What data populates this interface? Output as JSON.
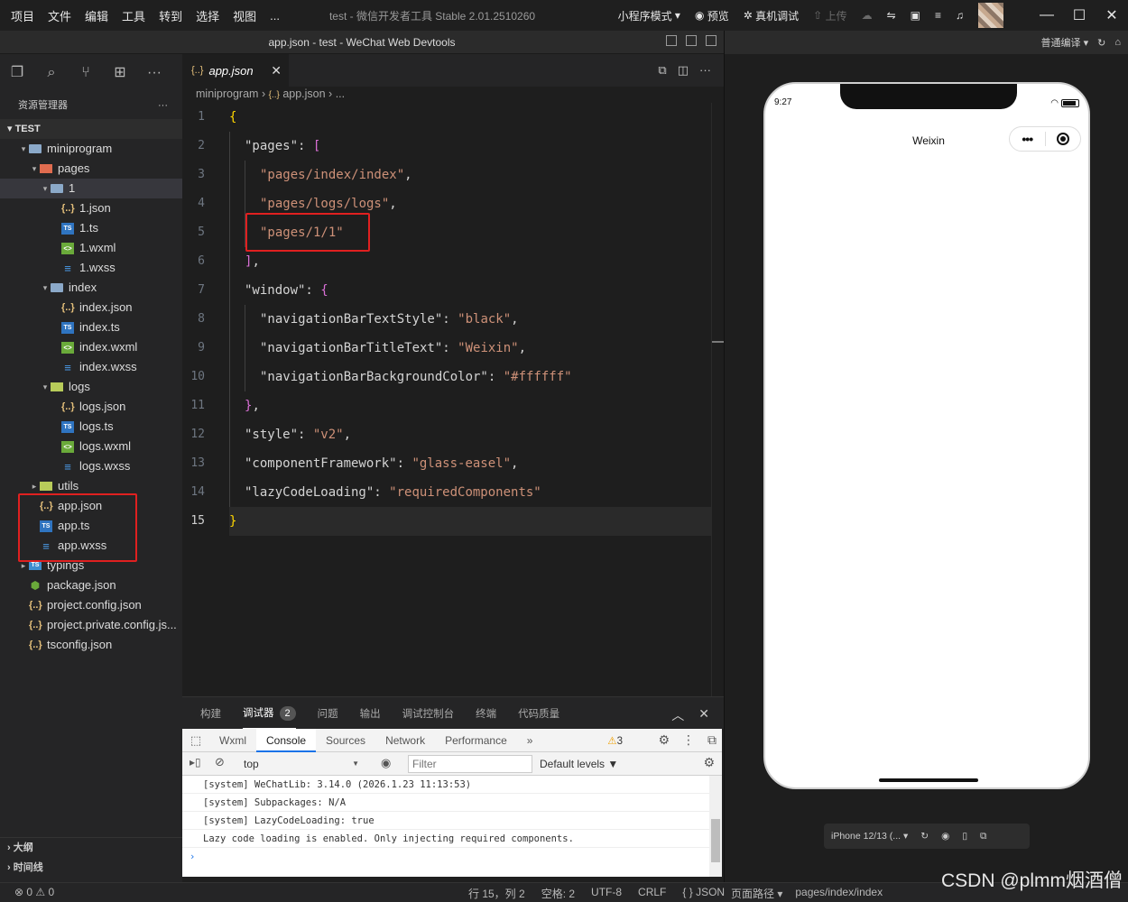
{
  "menu": {
    "items": [
      "项目",
      "文件",
      "编辑",
      "工具",
      "转到",
      "选择",
      "视图",
      "..."
    ],
    "app_title": "test - 微信开发者工具 Stable 2.01.2510260",
    "mode": "小程序模式",
    "preview": "预览",
    "real_debug": "真机调试",
    "upload": "上传"
  },
  "window": {
    "title": "app.json - test - WeChat Web Devtools",
    "compile_mode": "普通编译"
  },
  "explorer": {
    "header": "资源管理器",
    "more": "···",
    "project": "TEST",
    "tree": [
      {
        "depth": 1,
        "arrow": "▾",
        "icon": "folder",
        "label": "miniprogram"
      },
      {
        "depth": 2,
        "arrow": "▾",
        "icon": "folder-red",
        "label": "pages"
      },
      {
        "depth": 3,
        "arrow": "▾",
        "icon": "folder",
        "label": "1",
        "selected": true
      },
      {
        "depth": 4,
        "arrow": "",
        "icon": "json",
        "label": "1.json"
      },
      {
        "depth": 4,
        "arrow": "",
        "icon": "ts",
        "label": "1.ts"
      },
      {
        "depth": 4,
        "arrow": "",
        "icon": "wxml",
        "label": "1.wxml"
      },
      {
        "depth": 4,
        "arrow": "",
        "icon": "wxss",
        "label": "1.wxss"
      },
      {
        "depth": 3,
        "arrow": "▾",
        "icon": "folder",
        "label": "index"
      },
      {
        "depth": 4,
        "arrow": "",
        "icon": "json",
        "label": "index.json"
      },
      {
        "depth": 4,
        "arrow": "",
        "icon": "ts",
        "label": "index.ts"
      },
      {
        "depth": 4,
        "arrow": "",
        "icon": "wxml",
        "label": "index.wxml"
      },
      {
        "depth": 4,
        "arrow": "",
        "icon": "wxss",
        "label": "index.wxss"
      },
      {
        "depth": 3,
        "arrow": "▾",
        "icon": "folder-green",
        "label": "logs"
      },
      {
        "depth": 4,
        "arrow": "",
        "icon": "json",
        "label": "logs.json"
      },
      {
        "depth": 4,
        "arrow": "",
        "icon": "ts",
        "label": "logs.ts"
      },
      {
        "depth": 4,
        "arrow": "",
        "icon": "wxml",
        "label": "logs.wxml"
      },
      {
        "depth": 4,
        "arrow": "",
        "icon": "wxss",
        "label": "logs.wxss"
      },
      {
        "depth": 2,
        "arrow": "▸",
        "icon": "folder-green",
        "label": "utils"
      },
      {
        "depth": 2,
        "arrow": "",
        "icon": "json",
        "label": "app.json"
      },
      {
        "depth": 2,
        "arrow": "",
        "icon": "ts",
        "label": "app.ts"
      },
      {
        "depth": 2,
        "arrow": "",
        "icon": "wxss",
        "label": "app.wxss"
      },
      {
        "depth": 1,
        "arrow": "▸",
        "icon": "folder-blue",
        "label": "typings"
      },
      {
        "depth": 1,
        "arrow": "",
        "icon": "pkg",
        "label": "package.json"
      },
      {
        "depth": 1,
        "arrow": "",
        "icon": "json",
        "label": "project.config.json"
      },
      {
        "depth": 1,
        "arrow": "",
        "icon": "json",
        "label": "project.private.config.js..."
      },
      {
        "depth": 1,
        "arrow": "",
        "icon": "json",
        "label": "tsconfig.json"
      }
    ],
    "outline": "大纲",
    "timeline": "时间线"
  },
  "editor": {
    "tab": "app.json",
    "breadcrumb": [
      "miniprogram",
      "app.json",
      "..."
    ],
    "current_line": 15,
    "lines": [
      {
        "n": 1,
        "indent": 0,
        "parts": [
          {
            "c": "kb",
            "t": "{"
          }
        ]
      },
      {
        "n": 2,
        "indent": 1,
        "parts": [
          {
            "c": "k",
            "t": "\"pages\": "
          },
          {
            "c": "kp",
            "t": "["
          }
        ]
      },
      {
        "n": 3,
        "indent": 2,
        "parts": [
          {
            "c": "s",
            "t": "\"pages/index/index\""
          },
          {
            "c": "k",
            "t": ","
          }
        ]
      },
      {
        "n": 4,
        "indent": 2,
        "parts": [
          {
            "c": "s",
            "t": "\"pages/logs/logs\""
          },
          {
            "c": "k",
            "t": ","
          }
        ]
      },
      {
        "n": 5,
        "indent": 2,
        "parts": [
          {
            "c": "s",
            "t": "\"pages/1/1\""
          }
        ]
      },
      {
        "n": 6,
        "indent": 1,
        "parts": [
          {
            "c": "kp",
            "t": "]"
          },
          {
            "c": "k",
            "t": ","
          }
        ]
      },
      {
        "n": 7,
        "indent": 1,
        "parts": [
          {
            "c": "k",
            "t": "\"window\": "
          },
          {
            "c": "kp",
            "t": "{"
          }
        ]
      },
      {
        "n": 8,
        "indent": 2,
        "parts": [
          {
            "c": "k",
            "t": "\"navigationBarTextStyle\": "
          },
          {
            "c": "s",
            "t": "\"black\""
          },
          {
            "c": "k",
            "t": ","
          }
        ]
      },
      {
        "n": 9,
        "indent": 2,
        "parts": [
          {
            "c": "k",
            "t": "\"navigationBarTitleText\": "
          },
          {
            "c": "s",
            "t": "\"Weixin\""
          },
          {
            "c": "k",
            "t": ","
          }
        ]
      },
      {
        "n": 10,
        "indent": 2,
        "parts": [
          {
            "c": "k",
            "t": "\"navigationBarBackgroundColor\": "
          },
          {
            "c": "s",
            "t": "\"#ffffff\""
          }
        ]
      },
      {
        "n": 11,
        "indent": 1,
        "parts": [
          {
            "c": "kp",
            "t": "}"
          },
          {
            "c": "k",
            "t": ","
          }
        ]
      },
      {
        "n": 12,
        "indent": 1,
        "parts": [
          {
            "c": "k",
            "t": "\"style\": "
          },
          {
            "c": "s",
            "t": "\"v2\""
          },
          {
            "c": "k",
            "t": ","
          }
        ]
      },
      {
        "n": 13,
        "indent": 1,
        "parts": [
          {
            "c": "k",
            "t": "\"componentFramework\": "
          },
          {
            "c": "s",
            "t": "\"glass-easel\""
          },
          {
            "c": "k",
            "t": ","
          }
        ]
      },
      {
        "n": 14,
        "indent": 1,
        "parts": [
          {
            "c": "k",
            "t": "\"lazyCodeLoading\": "
          },
          {
            "c": "s",
            "t": "\"requiredComponents\""
          }
        ]
      },
      {
        "n": 15,
        "indent": 0,
        "parts": [
          {
            "c": "kb",
            "t": "}"
          }
        ]
      }
    ]
  },
  "panel": {
    "tabs": [
      "构建",
      "调试器",
      "问题",
      "输出",
      "调试控制台",
      "终端",
      "代码质量"
    ],
    "active": "调试器",
    "badge": "2"
  },
  "devtools": {
    "tabs": [
      "Wxml",
      "Console",
      "Sources",
      "Network",
      "Performance",
      "»"
    ],
    "active": "Console",
    "warnings": "3",
    "context": "top",
    "filter_placeholder": "Filter",
    "levels": "Default levels ▼",
    "console": [
      "[system] WeChatLib: 3.14.0 (2026.1.23 11:13:53)",
      "[system] Subpackages: N/A",
      "[system] LazyCodeLoading: true",
      "Lazy code loading is enabled. Only injecting required components."
    ],
    "prompt": "›"
  },
  "statusbar": {
    "problems": "⊗ 0 ⚠ 0",
    "position": "行 15，列 2",
    "spaces": "空格: 2",
    "encoding": "UTF-8",
    "eol": "CRLF",
    "lang": "{ } JSON",
    "page_path_label": "页面路径 ▾",
    "page_path": "pages/index/index"
  },
  "simulator": {
    "time": "9:27",
    "nav_title": "Weixin",
    "capsule_dots": "•••",
    "device": "iPhone 12/13 (... ▾"
  },
  "watermark": "CSDN @plmm烟酒僧"
}
